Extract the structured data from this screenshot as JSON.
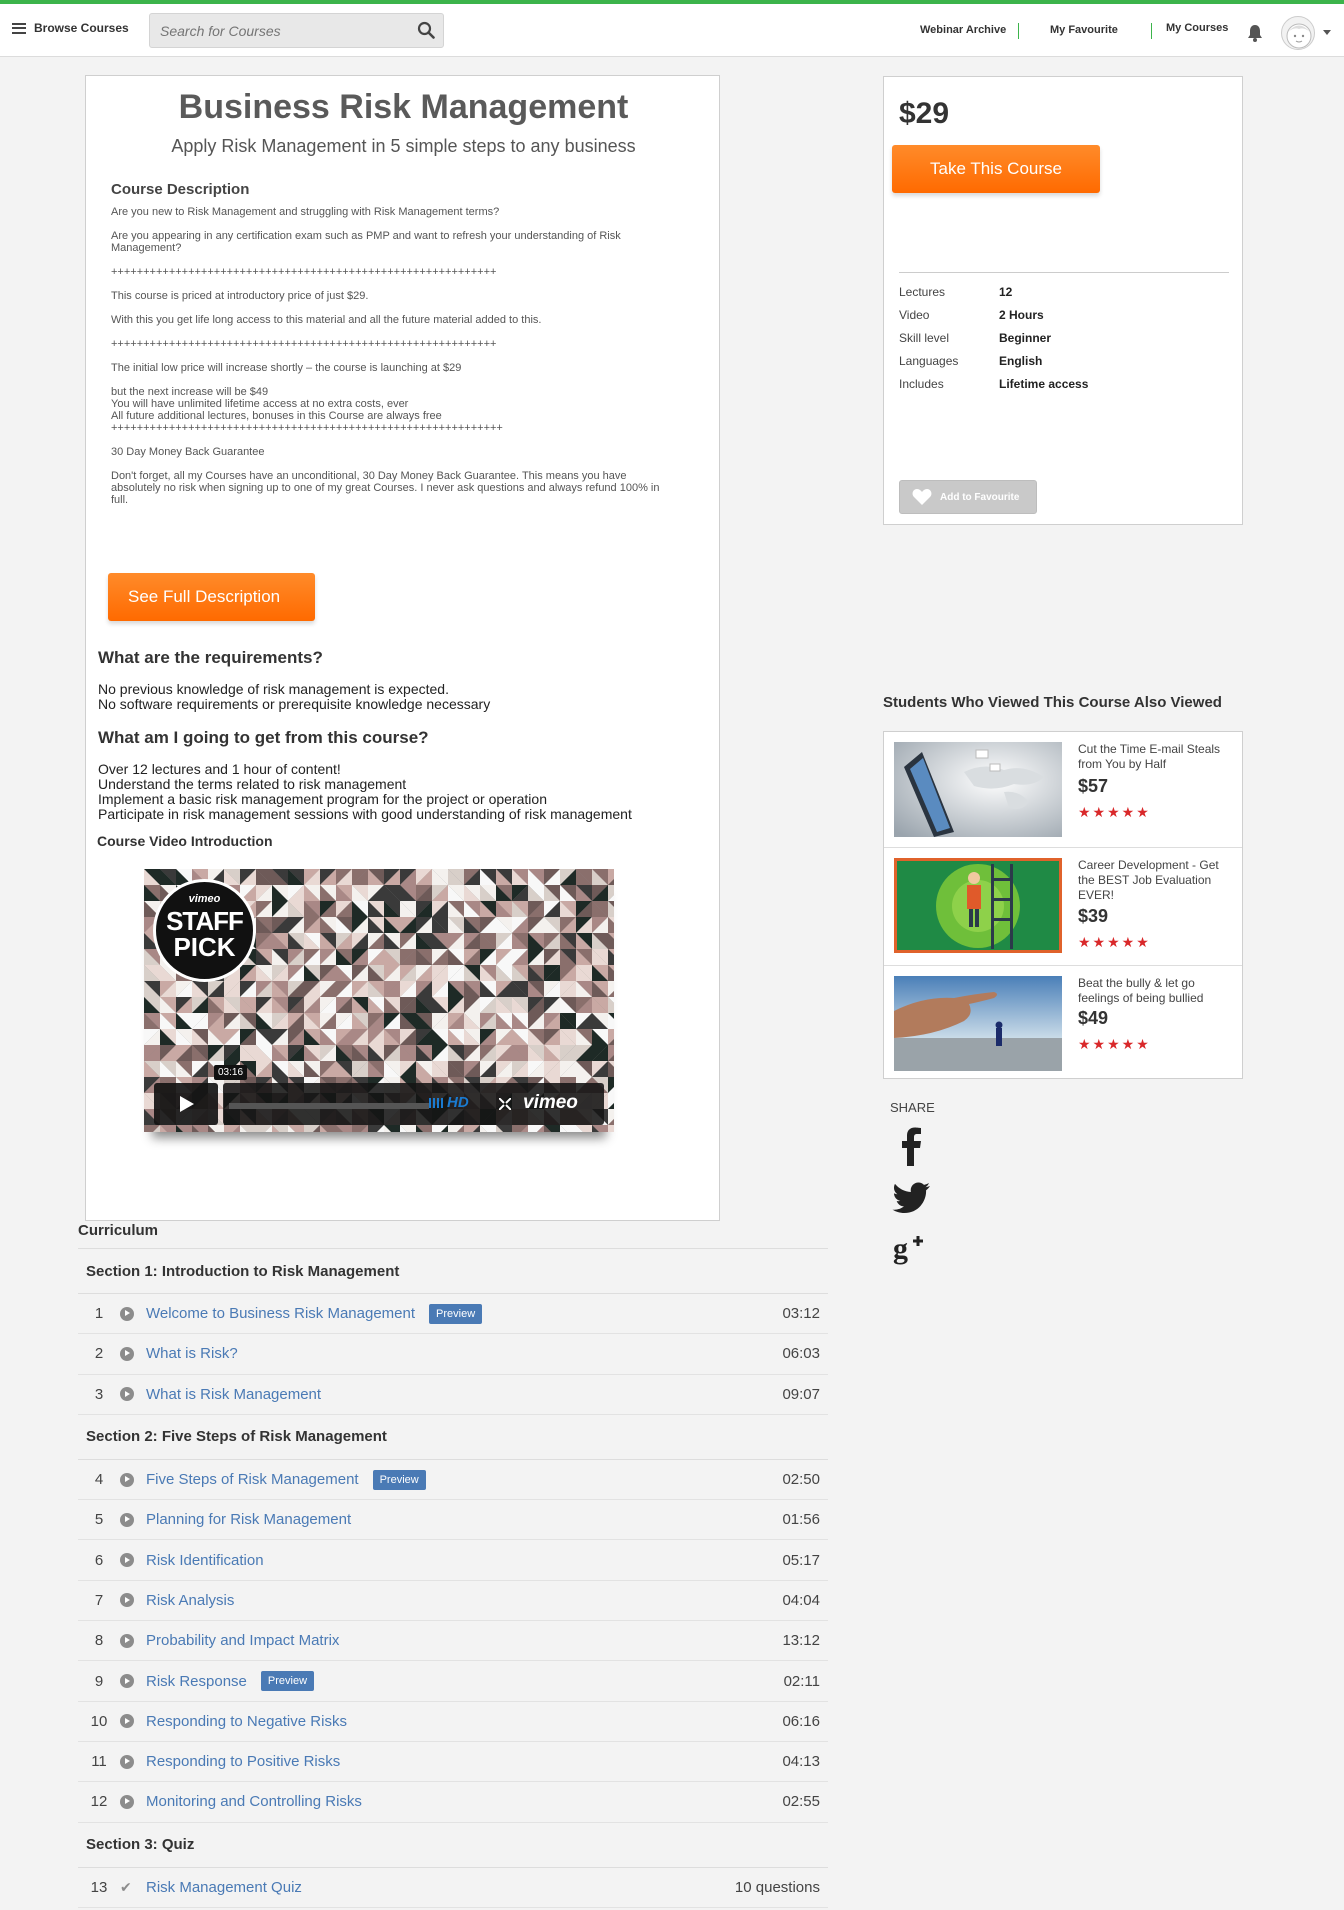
{
  "nav": {
    "browse_label": "Browse Courses",
    "search_placeholder": "Search for Courses",
    "webinar_archive": "Webinar Archive",
    "my_favourite": "My Favourite",
    "my_courses": "My Courses"
  },
  "course": {
    "title": "Business Risk Management",
    "subtitle": "Apply Risk Management in 5 simple steps to any business",
    "description_heading": "Course Description",
    "description": [
      "Are you new to Risk Management and struggling with Risk Management terms?",
      "Are you appearing in any certification exam such as PMP and want to refresh your understanding of Risk Management?",
      "++++++++++++++++++++++++++++++++++++++++++++++++++++++++++++",
      "This course is priced at introductory price of just $29.",
      "With this you get life long access to this material and all the future material added to this.",
      "++++++++++++++++++++++++++++++++++++++++++++++++++++++++++++",
      "The initial low price will increase shortly – the course is launching at $29",
      "but the next increase will be $49\nYou will have unlimited lifetime access at no extra costs, ever\nAll future additional lectures, bonuses in this Course are always free\n+++++++++++++++++++++++++++++++++++++++++++++++++++++++++++++",
      "30 Day Money Back Guarantee",
      "Don't forget, all my Courses have an unconditional, 30 Day Money Back Guarantee. This means you have absolutely no risk when signing up to one of my great Courses. I never ask questions and always refund 100% in full."
    ],
    "see_full_label": "See Full Description",
    "requirements_heading": "What are the requirements?",
    "requirements": [
      "No previous knowledge of risk management is expected.",
      "No software requirements or prerequisite knowledge necessary"
    ],
    "get_heading": "What am I going to get from this course?",
    "get_items": [
      "Over 12 lectures and 1 hour of content!",
      "Understand the terms related to risk management",
      "Implement a basic risk management program for the project or operation",
      "Participate in risk management sessions with good understanding of risk management"
    ],
    "video_heading": "Course Video Introduction",
    "video": {
      "badge_brand": "vimeo",
      "badge_line1": "STAFF",
      "badge_line2": "PICK",
      "time": "03:16",
      "hd": "HD",
      "brand": "vimeo"
    }
  },
  "sidebar": {
    "price": "$29",
    "take_label": "Take This Course",
    "stats": [
      {
        "k": "Lectures",
        "v": "12"
      },
      {
        "k": "Video",
        "v": "2 Hours"
      },
      {
        "k": "Skill level",
        "v": "Beginner"
      },
      {
        "k": "Languages",
        "v": "English"
      },
      {
        "k": "Includes",
        "v": "Lifetime access"
      }
    ],
    "fav_label": "Add to Favourite"
  },
  "also_viewed": {
    "heading": "Students Who Viewed This Course Also Viewed",
    "items": [
      {
        "title": "Cut the Time E-mail Steals from You by Half",
        "price": "$57",
        "stars": "★★★★★"
      },
      {
        "title": "Career Development - Get the BEST Job Evaluation EVER!",
        "price": "$39",
        "stars": "★★★★★"
      },
      {
        "title": "Beat the bully & let go feelings of being bullied",
        "price": "$49",
        "stars": "★★★★★"
      }
    ]
  },
  "share": {
    "label": "SHARE",
    "icons": [
      "facebook-icon",
      "twitter-icon",
      "google-plus-icon"
    ]
  },
  "curriculum": {
    "heading": "Curriculum",
    "sections": [
      {
        "title": "Section 1: Introduction to Risk Management",
        "lectures": [
          {
            "n": "1",
            "title": "Welcome to Business Risk Management",
            "preview": "Preview",
            "dur": "03:12"
          },
          {
            "n": "2",
            "title": "What is Risk?",
            "dur": "06:03"
          },
          {
            "n": "3",
            "title": "What is Risk Management",
            "dur": "09:07"
          }
        ]
      },
      {
        "title": "Section 2: Five Steps of Risk Management",
        "lectures": [
          {
            "n": "4",
            "title": "Five Steps of Risk Management",
            "preview": "Preview",
            "dur": "02:50"
          },
          {
            "n": "5",
            "title": "Planning for Risk Management",
            "dur": "01:56"
          },
          {
            "n": "6",
            "title": "Risk Identification",
            "dur": "05:17"
          },
          {
            "n": "7",
            "title": "Risk Analysis",
            "dur": "04:04"
          },
          {
            "n": "8",
            "title": "Probability and Impact Matrix",
            "dur": "13:12"
          },
          {
            "n": "9",
            "title": "Risk Response",
            "preview": "Preview",
            "dur": "02:11"
          },
          {
            "n": "10",
            "title": "Responding to Negative Risks",
            "dur": "06:16"
          },
          {
            "n": "11",
            "title": "Responding to Positive Risks",
            "dur": "04:13"
          },
          {
            "n": "12",
            "title": "Monitoring and Controlling Risks",
            "dur": "02:55"
          }
        ]
      },
      {
        "title": "Section 3: Quiz",
        "lectures": [
          {
            "n": "13",
            "title": "Risk Management Quiz",
            "quiz": true,
            "dur": "10 questions"
          }
        ]
      }
    ]
  },
  "colors": {
    "accent_green": "#3cb44b",
    "orange": "#ff7a12",
    "link_blue": "#4a7ab5",
    "star_red": "#d9282a"
  }
}
